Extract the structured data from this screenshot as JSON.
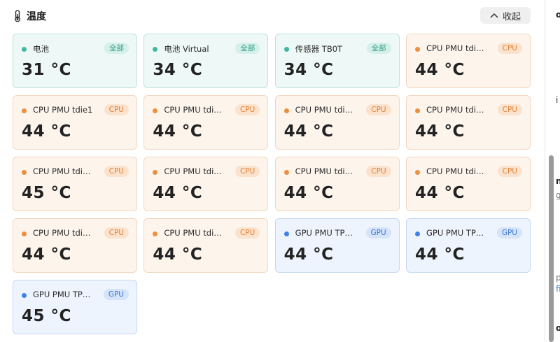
{
  "section": {
    "title": "温度",
    "collapse_label": "收起"
  },
  "sensors": [
    {
      "name": "电池",
      "tag": "全部",
      "value": "31 °C",
      "type": "all"
    },
    {
      "name": "电池 Virtual",
      "tag": "全部",
      "value": "34 °C",
      "type": "all"
    },
    {
      "name": "传感器 TB0T",
      "tag": "全部",
      "value": "34 °C",
      "type": "all"
    },
    {
      "name": "CPU PMU tdi…",
      "tag": "CPU",
      "value": "44 °C",
      "type": "cpu"
    },
    {
      "name": "CPU PMU tdie1",
      "tag": "CPU",
      "value": "44 °C",
      "type": "cpu"
    },
    {
      "name": "CPU PMU tdi…",
      "tag": "CPU",
      "value": "44 °C",
      "type": "cpu"
    },
    {
      "name": "CPU PMU tdi…",
      "tag": "CPU",
      "value": "44 °C",
      "type": "cpu"
    },
    {
      "name": "CPU PMU tdi…",
      "tag": "CPU",
      "value": "44 °C",
      "type": "cpu"
    },
    {
      "name": "CPU PMU tdi…",
      "tag": "CPU",
      "value": "45 °C",
      "type": "cpu"
    },
    {
      "name": "CPU PMU tdi…",
      "tag": "CPU",
      "value": "44 °C",
      "type": "cpu"
    },
    {
      "name": "CPU PMU tdi…",
      "tag": "CPU",
      "value": "44 °C",
      "type": "cpu"
    },
    {
      "name": "CPU PMU tdi…",
      "tag": "CPU",
      "value": "44 °C",
      "type": "cpu"
    },
    {
      "name": "CPU PMU tdi…",
      "tag": "CPU",
      "value": "44 °C",
      "type": "cpu"
    },
    {
      "name": "CPU PMU tdi…",
      "tag": "CPU",
      "value": "44 °C",
      "type": "cpu"
    },
    {
      "name": "GPU PMU TP…",
      "tag": "GPU",
      "value": "44 °C",
      "type": "gpu"
    },
    {
      "name": "GPU PMU TP…",
      "tag": "GPU",
      "value": "44 °C",
      "type": "gpu"
    },
    {
      "name": "GPU PMU TP…",
      "tag": "GPU",
      "value": "45 °C",
      "type": "gpu"
    }
  ],
  "side_fragments": [
    "o",
    "i",
    "n",
    "g",
    "p",
    "fi",
    "o"
  ],
  "colors": {
    "all_accent": "#3fb8a2",
    "cpu_accent": "#ee8f3d",
    "gpu_accent": "#3e82e6"
  },
  "scroll": {
    "position": 1.0
  }
}
